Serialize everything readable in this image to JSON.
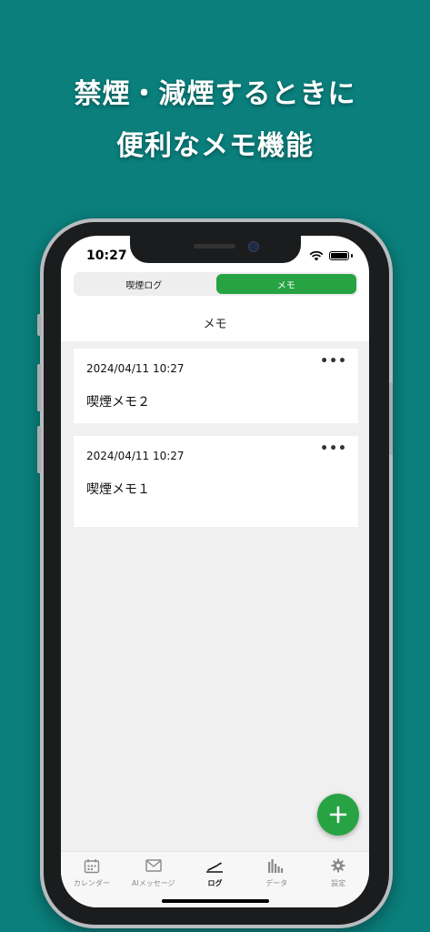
{
  "promo": {
    "line1": "禁煙・減煙するときに",
    "line2": "便利なメモ機能"
  },
  "status_bar": {
    "time": "10:27"
  },
  "segmented_control": {
    "options": [
      {
        "label": "喫煙ログ",
        "selected": false
      },
      {
        "label": "メモ",
        "selected": true
      }
    ]
  },
  "page_title": "メモ",
  "memos": [
    {
      "date": "2024/04/11 10:27",
      "text": "喫煙メモ２",
      "more": "•••"
    },
    {
      "date": "2024/04/11 10:27",
      "text": "喫煙メモ１",
      "more": "•••"
    }
  ],
  "tabbar": {
    "items": [
      {
        "label": "カレンダー",
        "icon": "calendar-icon"
      },
      {
        "label": "AIメッセージ",
        "icon": "envelope-icon"
      },
      {
        "label": "ログ",
        "icon": "log-icon",
        "active": true
      },
      {
        "label": "データ",
        "icon": "chart-icon"
      },
      {
        "label": "設定",
        "icon": "gear-icon"
      }
    ]
  },
  "colors": {
    "background": "#0a7f7c",
    "accent": "#27a344"
  }
}
